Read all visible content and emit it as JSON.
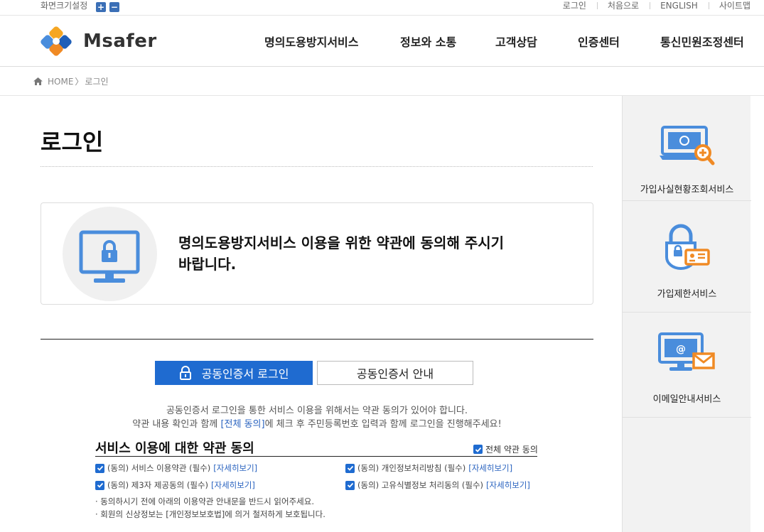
{
  "util": {
    "font_setting": "화면크기설정",
    "zoom_in": "+",
    "zoom_out": "−",
    "links": [
      "로그인",
      "처음으로",
      "ENGLISH",
      "사이트맵"
    ]
  },
  "logo": {
    "text": "Msafer"
  },
  "gnb": [
    "명의도용방지서비스",
    "정보와 소통",
    "고객상담",
    "인증센터",
    "통신민원조정센터"
  ],
  "breadcrumb": {
    "home": "HOME",
    "sep": "〉",
    "current": "로그인"
  },
  "page_title": "로그인",
  "notice": {
    "line1": "명의도용방지서비스 이용을 위한 약관에 동의해 주시기",
    "line2": "바랍니다."
  },
  "tabs": {
    "active": "공동인증서 로그인",
    "idle": "공동인증서 안내"
  },
  "guide": {
    "line1": "공동인증서 로그인을 통한 서비스 이용을 위해서는 약관 동의가 있어야 합니다.",
    "line2_pre": "약관 내용 확인과 함께 ",
    "line2_hl": "[전체 동의]",
    "line2_post": "에 체크 후 주민등록번호 입력과 함께 로그인을 진행해주세요!"
  },
  "terms": {
    "title": "서비스 이용에 대한 약관 동의",
    "all_agree": "전체 약관 동의",
    "more": "[자세히보기]",
    "items": [
      "(동의) 서비스 이용약관 (필수)",
      "(동의) 개인정보처리방침 (필수)",
      "(동의) 제3자 제공동의 (필수)",
      "(동의) 고유식별정보 처리동의 (필수)"
    ],
    "notes": [
      "· 동의하시기 전에 아래의 이용약관 안내문을 반드시 읽어주세요.",
      "· 회원의 신상정보는 [개인정보보호법]에 의거 철저하게 보호됩니다."
    ]
  },
  "sidebar": [
    {
      "label": "가입사실현황조회서비스",
      "icon": "laptop-search-icon"
    },
    {
      "label": "가입제한서비스",
      "icon": "lock-id-card-icon"
    },
    {
      "label": "이메일안내서비스",
      "icon": "monitor-email-icon"
    }
  ],
  "colors": {
    "primary": "#1f6bd0",
    "link": "#2b64c0",
    "accent_orange": "#f08a24",
    "icon_blue": "#4a8ddc"
  }
}
